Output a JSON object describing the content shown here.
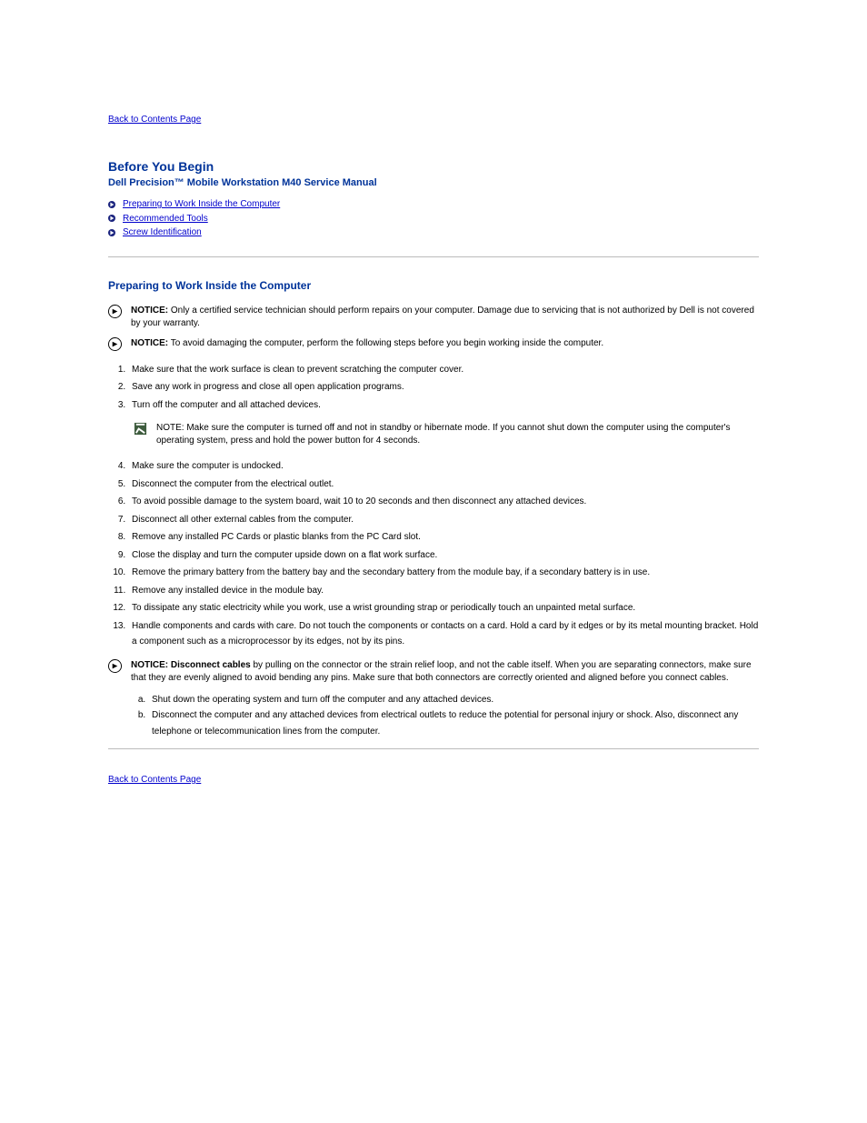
{
  "back_link": "Back to Contents Page",
  "heading": "Before You Begin",
  "doc_title": "Dell Precision™ Mobile Workstation M40 Service Manual",
  "toc": {
    "item1": "Preparing to Work Inside the Computer",
    "item2": "Recommended Tools",
    "item3": "Screw Identification"
  },
  "section1": {
    "heading": "Preparing to Work Inside the Computer",
    "notice1": {
      "label": "NOTICE:",
      "text": "Only a certified service technician should perform repairs on your computer. Damage due to servicing that is not authorized by Dell is not covered by your warranty."
    },
    "notice2": {
      "label": "NOTICE:",
      "text": "To avoid damaging the computer, perform the following steps before you begin working inside the computer."
    },
    "step1": "Make sure that the work surface is clean to prevent scratching the computer cover.",
    "step2": "Save any work in progress and close all open application programs.",
    "step3": "Turn off the computer and all attached devices.",
    "note": {
      "label": "NOTE:",
      "text": "Make sure the computer is turned off and not in standby or hibernate mode. If you cannot shut down the computer using the computer's operating system, press and hold the power button for 4 seconds."
    },
    "step4": "Make sure the computer is undocked.",
    "step5": "Disconnect the computer from the electrical outlet.",
    "step6": "To avoid possible damage to the system board, wait 10 to 20 seconds and then disconnect any attached devices.",
    "step7": "Disconnect all other external cables from the computer.",
    "step8": "Remove any installed PC Cards or plastic blanks from the PC Card slot.",
    "step9": "Close the display and turn the computer upside down on a flat work surface.",
    "step10": "Remove the primary battery from the battery bay and the secondary battery from the module bay, if a secondary battery is in use.",
    "step11": "Remove any installed device in the module bay.",
    "step12": "To dissipate any static electricity while you work, use a wrist grounding strap or periodically touch an unpainted metal surface.",
    "step13": "Handle components and cards with care. Do not touch the components or contacts on a card. Hold a card by it edges or by its metal mounting bracket. Hold a component such as a microprocessor by its edges, not by its pins.",
    "notice3": {
      "label": "NOTICE:",
      "intro": "Disconnect cables",
      "text": " by pulling on the connector or the strain relief loop, and not the cable itself. When you are separating connectors, make sure that they are evenly aligned to avoid bending any pins. Make sure that both connectors are correctly oriented and aligned before you connect cables."
    },
    "disconnect_sub": {
      "a": "Shut down the operating system and turn off the computer and any attached devices.",
      "b": "Disconnect the computer and any attached devices from electrical outlets to reduce the potential for personal injury or shock. Also, disconnect any telephone or telecommunication lines from the computer."
    }
  },
  "back_link_bottom": "Back to Contents Page"
}
